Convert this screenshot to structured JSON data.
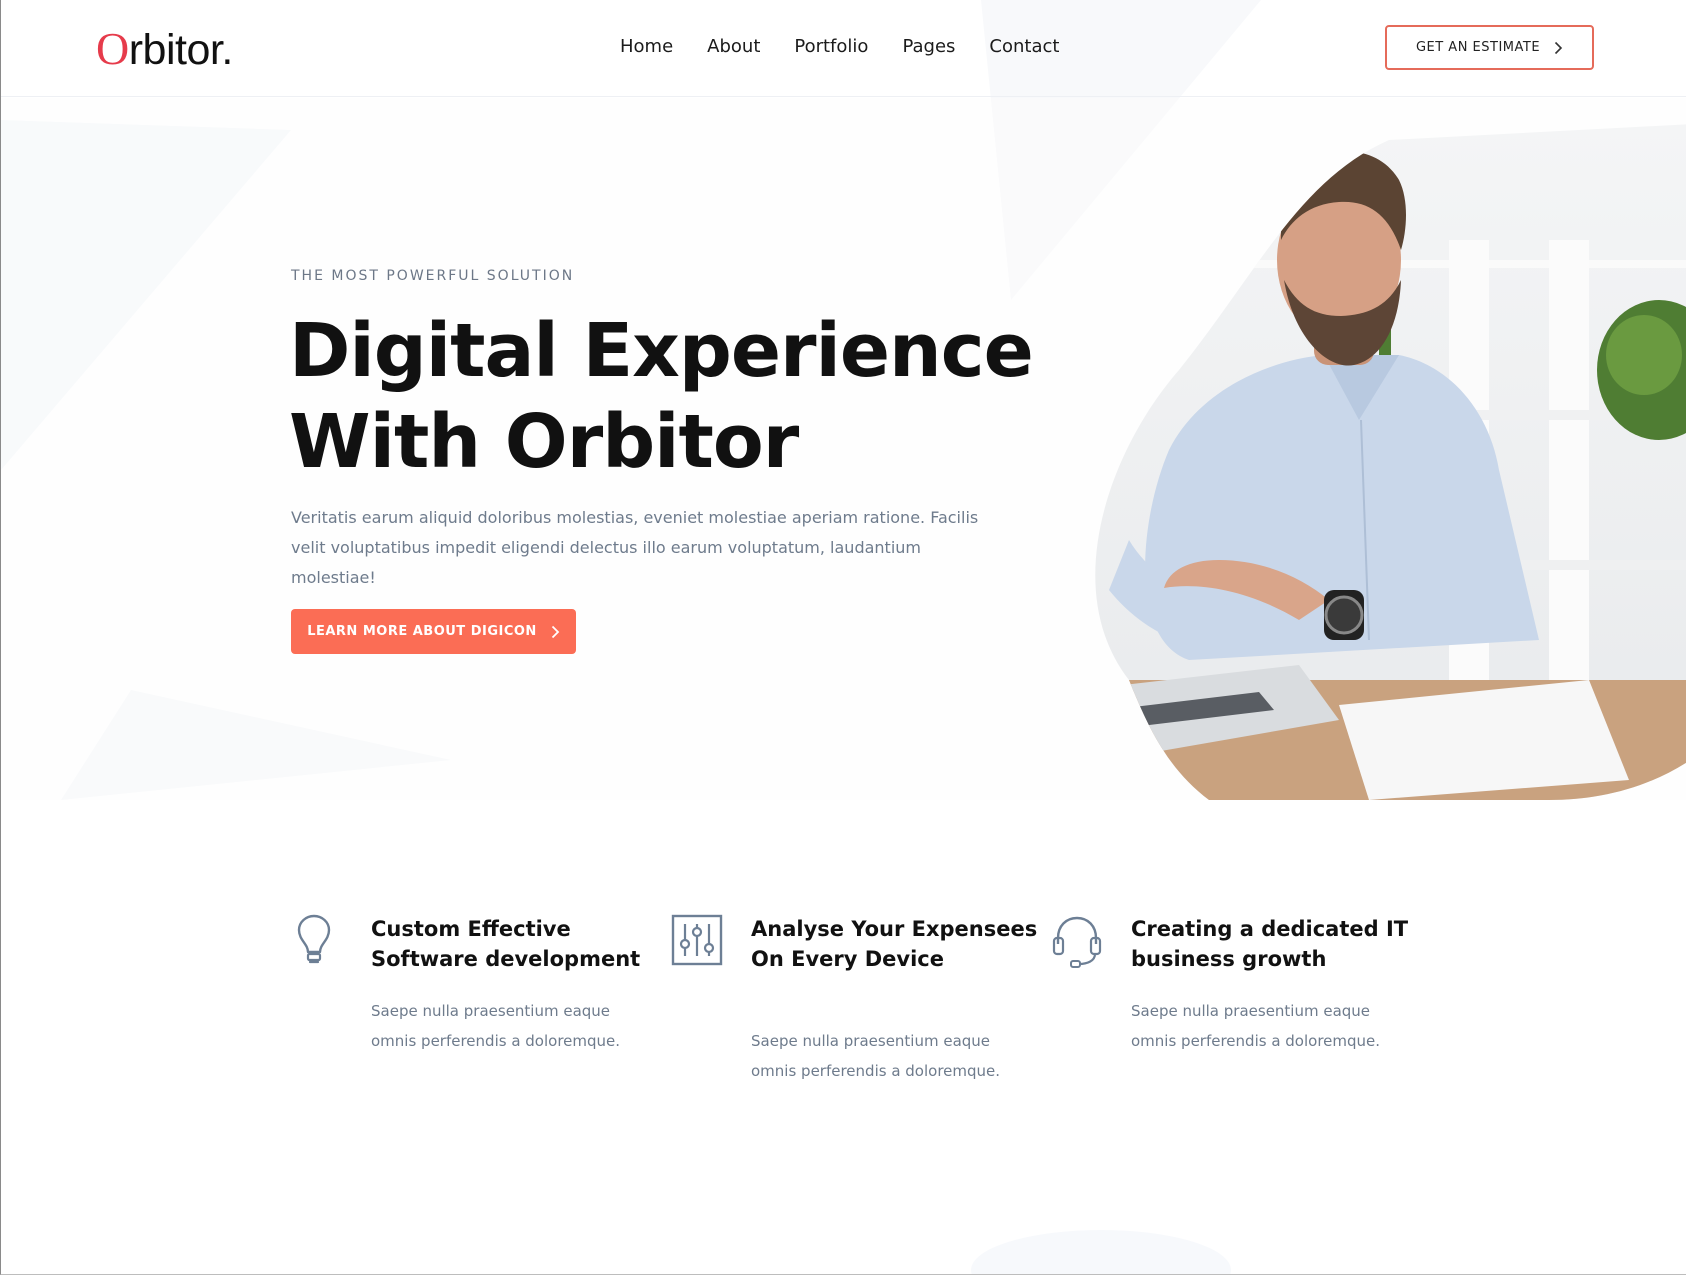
{
  "header": {
    "logo_first": "O",
    "logo_rest": "rbitor.",
    "nav": [
      "Home",
      "About",
      "Portfolio",
      "Pages",
      "Contact"
    ],
    "estimate_label": "GET AN ESTIMATE"
  },
  "hero": {
    "kicker": "THE MOST POWERFUL SOLUTION",
    "title_line1": "Digital Experience",
    "title_line2": "With Orbitor",
    "description": "Veritatis earum aliquid doloribus molestias, eveniet molestiae aperiam ratione. Facilis velit voluptatibus impedit eligendi delectus illo earum voluptatum, laudantium molestiae!",
    "cta_label": "LEARN MORE ABOUT DIGICON"
  },
  "features": [
    {
      "icon": "lightbulb-icon",
      "title": "Custom Effective Software development",
      "text": "Saepe nulla praesentium eaque omnis perferendis a doloremque."
    },
    {
      "icon": "sliders-icon",
      "title": "Analyse Your Expensees On Every Device",
      "text": "Saepe nulla praesentium eaque omnis perferendis a doloremque."
    },
    {
      "icon": "headset-icon",
      "title": "Creating a dedicated IT business growth",
      "text": "Saepe nulla praesentium eaque omnis perferendis a doloremque."
    }
  ],
  "colors": {
    "accent": "#fb6d55",
    "logo_red": "#e63b4b",
    "text_muted": "#6e7b8c",
    "icon_slate": "#6d7f95"
  }
}
